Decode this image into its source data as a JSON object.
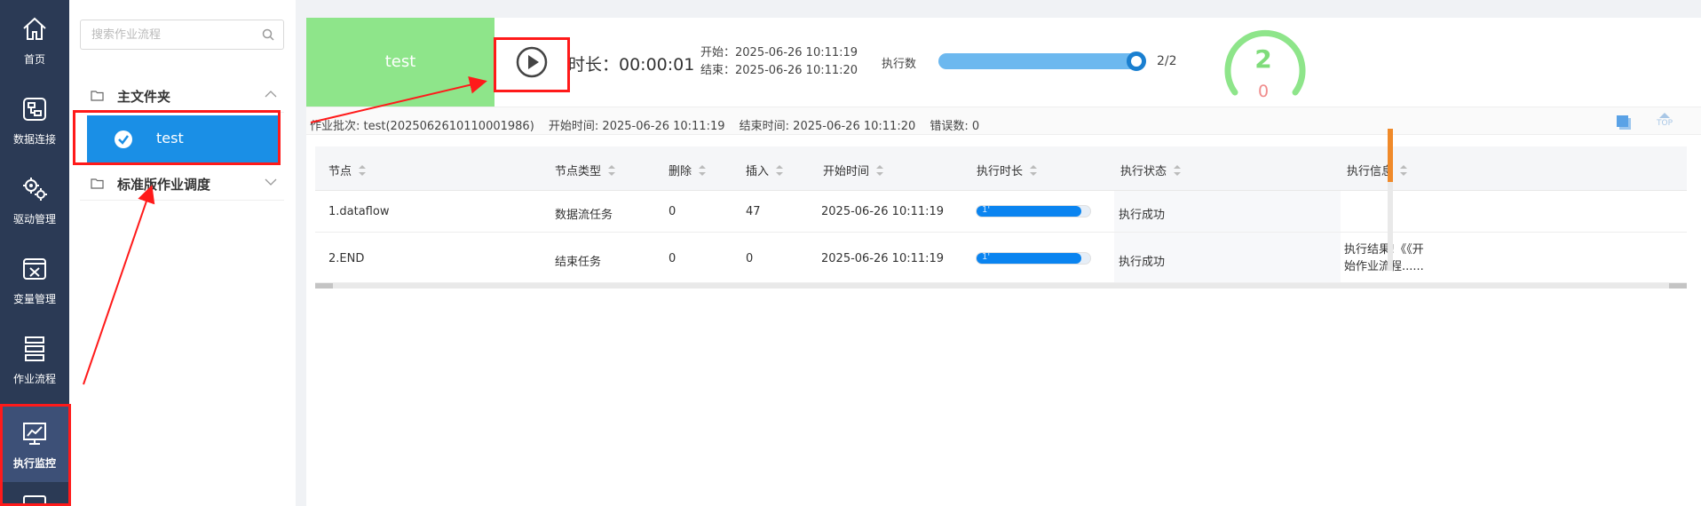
{
  "nav": {
    "items": [
      {
        "label": "首页",
        "icon": "home-icon"
      },
      {
        "label": "数据连接",
        "icon": "data-connection-icon"
      },
      {
        "label": "驱动管理",
        "icon": "driver-gears-icon"
      },
      {
        "label": "变量管理",
        "icon": "variable-icon"
      },
      {
        "label": "作业流程",
        "icon": "workflow-icon"
      },
      {
        "label": "执行监控",
        "icon": "monitor-chart-icon",
        "active": true
      }
    ]
  },
  "tree": {
    "search_placeholder": "搜索作业流程",
    "folders": [
      {
        "name": "主文件夹",
        "expanded": true,
        "items": [
          {
            "name": "test",
            "selected": true
          }
        ]
      },
      {
        "name": "标准版作业调度",
        "expanded": false
      }
    ]
  },
  "header": {
    "job_name": "test",
    "duration_text": "时长：00:00:01",
    "start_text": "开始：2025-06-26 10:11:19",
    "end_text": "结束：2025-06-26 10:11:20",
    "exec_label": "执行数",
    "exec_progress": 1.0,
    "exec_count": "2/2",
    "success_count": "2",
    "error_count": "0"
  },
  "batch": {
    "batch_text": "作业批次: test(2025062610110001986)",
    "start_text": "开始时间: 2025-06-26 10:11:19",
    "end_text": "结束时间: 2025-06-26 10:11:20",
    "error_text": "错误数: 0",
    "top_label": "TOP"
  },
  "table": {
    "columns": [
      "节点",
      "节点类型",
      "删除",
      "插入",
      "开始时间",
      "执行时长",
      "执行状态",
      "执行信息"
    ],
    "rows": [
      {
        "node": "1.dataflow",
        "type": "数据流任务",
        "deleted": "0",
        "inserted": "47",
        "start": "2025-06-26 10:11:19",
        "duration_label": "1'",
        "duration_fraction": 0.92,
        "status": "执行成功",
        "info": ""
      },
      {
        "node": "2.END",
        "type": "结束任务",
        "deleted": "0",
        "inserted": "0",
        "start": "2025-06-26 10:11:19",
        "duration_label": "1'",
        "duration_fraction": 0.92,
        "status": "执行成功",
        "info": "执行结果!《《开始作业流程......"
      }
    ]
  },
  "colors": {
    "nav_bg": "#2b3a55",
    "accent_blue": "#1a8fe6",
    "success_green": "#8ee58a",
    "error_red": "#f08c8c",
    "annotation_red": "#ff1a1a"
  }
}
